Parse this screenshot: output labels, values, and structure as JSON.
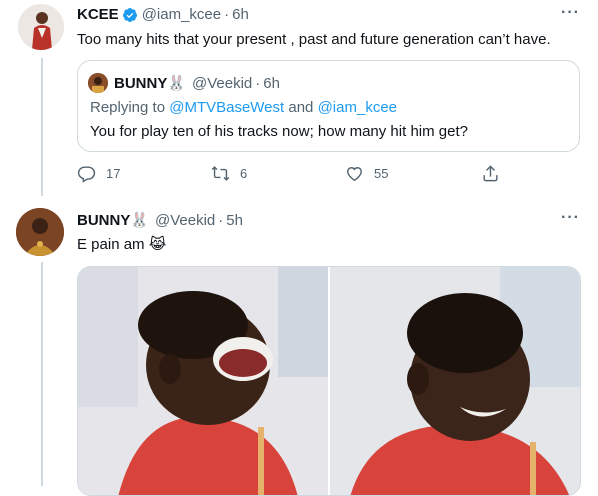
{
  "tweet1": {
    "name": "KCEE",
    "handle": "@iam_kcee",
    "separator": "·",
    "time": "6h",
    "more": "···",
    "text": "Too many hits that your present , past and future generation can’t have.",
    "quote": {
      "name": "BUNNY🐰",
      "handle": "@Veekid",
      "separator": "·",
      "time": "6h",
      "replying_prefix": "Replying to",
      "mention1": "@MTVBaseWest",
      "and": "and",
      "mention2": "@iam_kcee",
      "text": "You for play ten of his tracks now; how many hit him get?"
    },
    "actions": {
      "reply_count": "17",
      "retweet_count": "6",
      "like_count": "55"
    }
  },
  "tweet2": {
    "name": "BUNNY🐰",
    "handle": "@Veekid",
    "separator": "·",
    "time": "5h",
    "more": "···",
    "text": "E pain am 😹"
  },
  "colors": {
    "link": "#1d9bf0",
    "secondary_text": "#536471",
    "verified": "#1d9bf0",
    "border": "#cfd9de"
  }
}
